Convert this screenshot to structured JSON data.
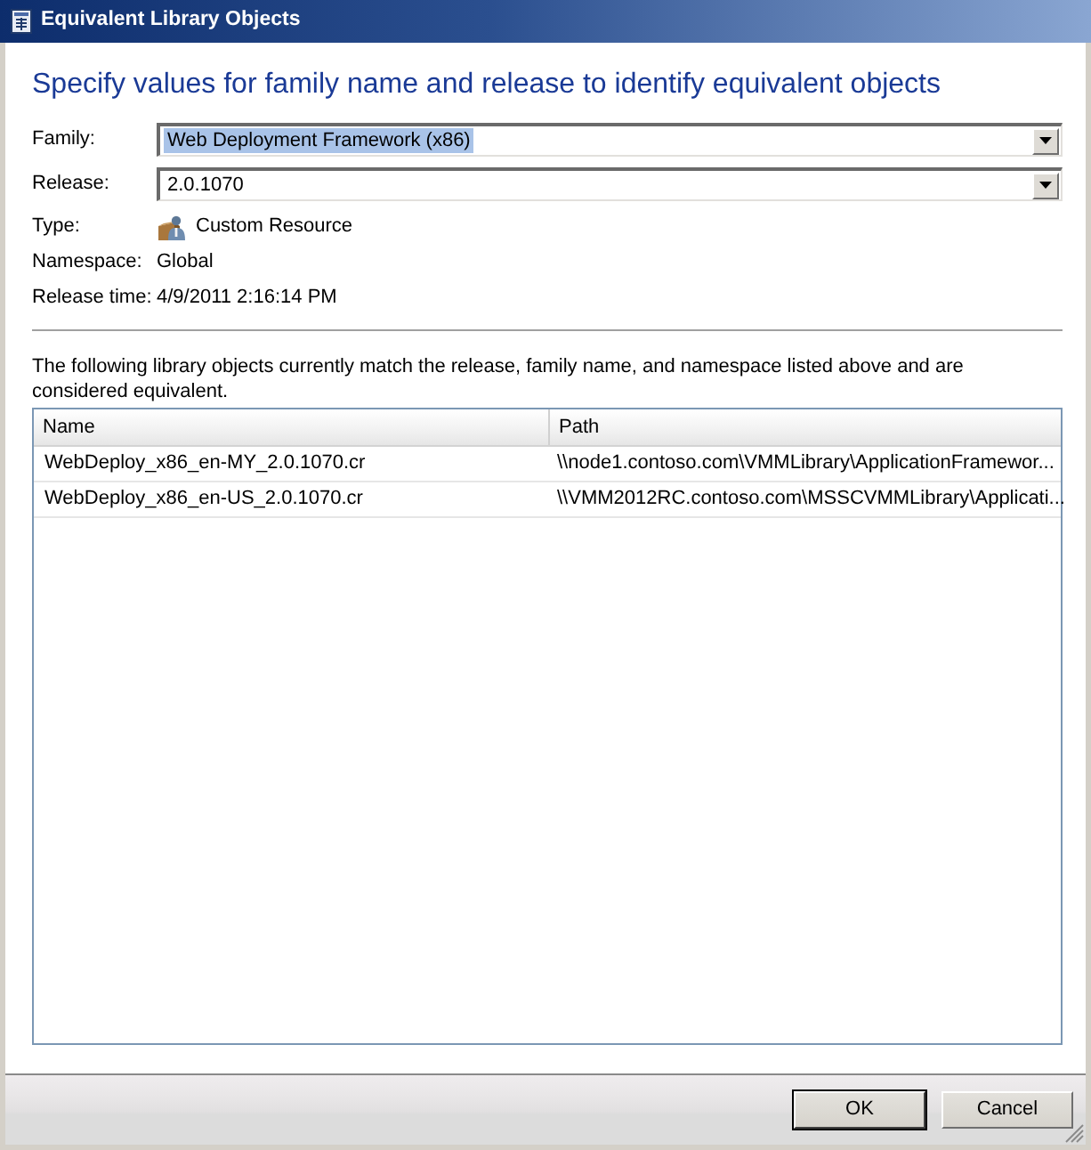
{
  "window": {
    "title": "Equivalent Library Objects"
  },
  "heading": "Specify values for family name and release to identify equivalent objects",
  "properties": [
    {
      "kind": "dropdown",
      "label": "Family:",
      "value": "Web Deployment Framework (x86)",
      "highlighted": true
    },
    {
      "kind": "dropdown",
      "label": "Release:",
      "value": "2.0.1070",
      "highlighted": false
    },
    {
      "kind": "icon_text",
      "label": "Type:",
      "value": "Custom Resource"
    },
    {
      "kind": "text",
      "label": "Namespace:",
      "value": "Global"
    },
    {
      "kind": "text",
      "label": "Release time:",
      "value": "4/9/2011 2:16:14 PM"
    }
  ],
  "description": "The following library objects currently match the release, family name, and namespace listed above and are considered equivalent.",
  "table": {
    "columns": [
      "Name",
      "Path"
    ],
    "rows": [
      [
        "WebDeploy_x86_en-MY_2.0.1070.cr",
        "\\\\node1.contoso.com\\VMMLibrary\\ApplicationFramewor..."
      ],
      [
        "WebDeploy_x86_en-US_2.0.1070.cr",
        "\\\\VMM2012RC.contoso.com\\MSSCVMMLibrary\\Applicati..."
      ]
    ]
  },
  "buttons": [
    {
      "label": "OK",
      "default": true
    },
    {
      "label": "Cancel",
      "default": false
    }
  ]
}
